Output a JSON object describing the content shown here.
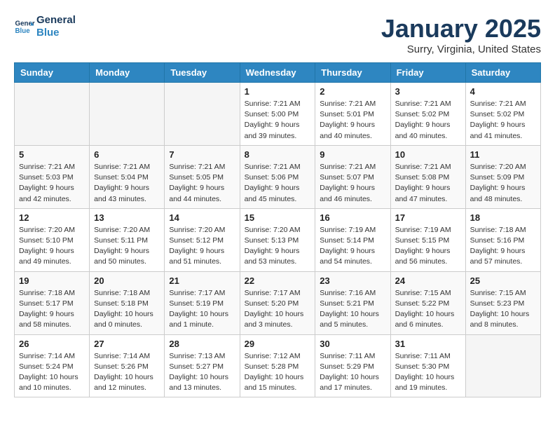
{
  "logo": {
    "line1": "General",
    "line2": "Blue"
  },
  "header": {
    "month": "January 2025",
    "location": "Surry, Virginia, United States"
  },
  "weekdays": [
    "Sunday",
    "Monday",
    "Tuesday",
    "Wednesday",
    "Thursday",
    "Friday",
    "Saturday"
  ],
  "weeks": [
    [
      {
        "day": "",
        "sunrise": "",
        "sunset": "",
        "daylight": ""
      },
      {
        "day": "",
        "sunrise": "",
        "sunset": "",
        "daylight": ""
      },
      {
        "day": "",
        "sunrise": "",
        "sunset": "",
        "daylight": ""
      },
      {
        "day": "1",
        "sunrise": "Sunrise: 7:21 AM",
        "sunset": "Sunset: 5:00 PM",
        "daylight": "Daylight: 9 hours and 39 minutes."
      },
      {
        "day": "2",
        "sunrise": "Sunrise: 7:21 AM",
        "sunset": "Sunset: 5:01 PM",
        "daylight": "Daylight: 9 hours and 40 minutes."
      },
      {
        "day": "3",
        "sunrise": "Sunrise: 7:21 AM",
        "sunset": "Sunset: 5:02 PM",
        "daylight": "Daylight: 9 hours and 40 minutes."
      },
      {
        "day": "4",
        "sunrise": "Sunrise: 7:21 AM",
        "sunset": "Sunset: 5:02 PM",
        "daylight": "Daylight: 9 hours and 41 minutes."
      }
    ],
    [
      {
        "day": "5",
        "sunrise": "Sunrise: 7:21 AM",
        "sunset": "Sunset: 5:03 PM",
        "daylight": "Daylight: 9 hours and 42 minutes."
      },
      {
        "day": "6",
        "sunrise": "Sunrise: 7:21 AM",
        "sunset": "Sunset: 5:04 PM",
        "daylight": "Daylight: 9 hours and 43 minutes."
      },
      {
        "day": "7",
        "sunrise": "Sunrise: 7:21 AM",
        "sunset": "Sunset: 5:05 PM",
        "daylight": "Daylight: 9 hours and 44 minutes."
      },
      {
        "day": "8",
        "sunrise": "Sunrise: 7:21 AM",
        "sunset": "Sunset: 5:06 PM",
        "daylight": "Daylight: 9 hours and 45 minutes."
      },
      {
        "day": "9",
        "sunrise": "Sunrise: 7:21 AM",
        "sunset": "Sunset: 5:07 PM",
        "daylight": "Daylight: 9 hours and 46 minutes."
      },
      {
        "day": "10",
        "sunrise": "Sunrise: 7:21 AM",
        "sunset": "Sunset: 5:08 PM",
        "daylight": "Daylight: 9 hours and 47 minutes."
      },
      {
        "day": "11",
        "sunrise": "Sunrise: 7:20 AM",
        "sunset": "Sunset: 5:09 PM",
        "daylight": "Daylight: 9 hours and 48 minutes."
      }
    ],
    [
      {
        "day": "12",
        "sunrise": "Sunrise: 7:20 AM",
        "sunset": "Sunset: 5:10 PM",
        "daylight": "Daylight: 9 hours and 49 minutes."
      },
      {
        "day": "13",
        "sunrise": "Sunrise: 7:20 AM",
        "sunset": "Sunset: 5:11 PM",
        "daylight": "Daylight: 9 hours and 50 minutes."
      },
      {
        "day": "14",
        "sunrise": "Sunrise: 7:20 AM",
        "sunset": "Sunset: 5:12 PM",
        "daylight": "Daylight: 9 hours and 51 minutes."
      },
      {
        "day": "15",
        "sunrise": "Sunrise: 7:20 AM",
        "sunset": "Sunset: 5:13 PM",
        "daylight": "Daylight: 9 hours and 53 minutes."
      },
      {
        "day": "16",
        "sunrise": "Sunrise: 7:19 AM",
        "sunset": "Sunset: 5:14 PM",
        "daylight": "Daylight: 9 hours and 54 minutes."
      },
      {
        "day": "17",
        "sunrise": "Sunrise: 7:19 AM",
        "sunset": "Sunset: 5:15 PM",
        "daylight": "Daylight: 9 hours and 56 minutes."
      },
      {
        "day": "18",
        "sunrise": "Sunrise: 7:18 AM",
        "sunset": "Sunset: 5:16 PM",
        "daylight": "Daylight: 9 hours and 57 minutes."
      }
    ],
    [
      {
        "day": "19",
        "sunrise": "Sunrise: 7:18 AM",
        "sunset": "Sunset: 5:17 PM",
        "daylight": "Daylight: 9 hours and 58 minutes."
      },
      {
        "day": "20",
        "sunrise": "Sunrise: 7:18 AM",
        "sunset": "Sunset: 5:18 PM",
        "daylight": "Daylight: 10 hours and 0 minutes."
      },
      {
        "day": "21",
        "sunrise": "Sunrise: 7:17 AM",
        "sunset": "Sunset: 5:19 PM",
        "daylight": "Daylight: 10 hours and 1 minute."
      },
      {
        "day": "22",
        "sunrise": "Sunrise: 7:17 AM",
        "sunset": "Sunset: 5:20 PM",
        "daylight": "Daylight: 10 hours and 3 minutes."
      },
      {
        "day": "23",
        "sunrise": "Sunrise: 7:16 AM",
        "sunset": "Sunset: 5:21 PM",
        "daylight": "Daylight: 10 hours and 5 minutes."
      },
      {
        "day": "24",
        "sunrise": "Sunrise: 7:15 AM",
        "sunset": "Sunset: 5:22 PM",
        "daylight": "Daylight: 10 hours and 6 minutes."
      },
      {
        "day": "25",
        "sunrise": "Sunrise: 7:15 AM",
        "sunset": "Sunset: 5:23 PM",
        "daylight": "Daylight: 10 hours and 8 minutes."
      }
    ],
    [
      {
        "day": "26",
        "sunrise": "Sunrise: 7:14 AM",
        "sunset": "Sunset: 5:24 PM",
        "daylight": "Daylight: 10 hours and 10 minutes."
      },
      {
        "day": "27",
        "sunrise": "Sunrise: 7:14 AM",
        "sunset": "Sunset: 5:26 PM",
        "daylight": "Daylight: 10 hours and 12 minutes."
      },
      {
        "day": "28",
        "sunrise": "Sunrise: 7:13 AM",
        "sunset": "Sunset: 5:27 PM",
        "daylight": "Daylight: 10 hours and 13 minutes."
      },
      {
        "day": "29",
        "sunrise": "Sunrise: 7:12 AM",
        "sunset": "Sunset: 5:28 PM",
        "daylight": "Daylight: 10 hours and 15 minutes."
      },
      {
        "day": "30",
        "sunrise": "Sunrise: 7:11 AM",
        "sunset": "Sunset: 5:29 PM",
        "daylight": "Daylight: 10 hours and 17 minutes."
      },
      {
        "day": "31",
        "sunrise": "Sunrise: 7:11 AM",
        "sunset": "Sunset: 5:30 PM",
        "daylight": "Daylight: 10 hours and 19 minutes."
      },
      {
        "day": "",
        "sunrise": "",
        "sunset": "",
        "daylight": ""
      }
    ]
  ]
}
